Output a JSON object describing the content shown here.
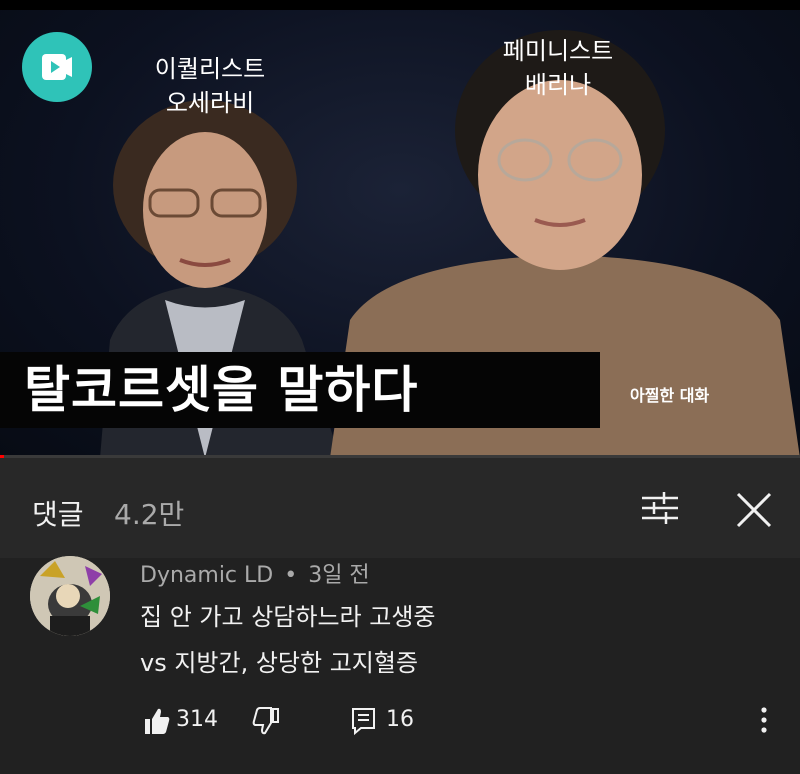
{
  "video": {
    "left_person_label_line1": "이퀄리스트",
    "left_person_label_line2": "오세라비",
    "right_person_label_line1": "페미니스트",
    "right_person_label_line2": "배리나",
    "title_banner": "탈코르셋을 말하다",
    "channel_tag": "아찔한 대화",
    "progress_fraction": 0.005,
    "accent_color": "#2fc3b8"
  },
  "comments": {
    "title": "댓글",
    "count": "4.2만",
    "sort_icon": "sort-icon",
    "close_icon": "close-icon"
  },
  "comment": {
    "author": "Dynamic LD",
    "separator": "•",
    "time": "3일 전",
    "line1": "집 안 가고 상담하느라 고생중",
    "line2": "vs 지방간, 상당한 고지혈증",
    "like_count": "314",
    "reply_count": "16",
    "icons": [
      "thumbs-up-icon",
      "thumbs-down-icon",
      "reply-icon",
      "more-vert-icon"
    ]
  }
}
